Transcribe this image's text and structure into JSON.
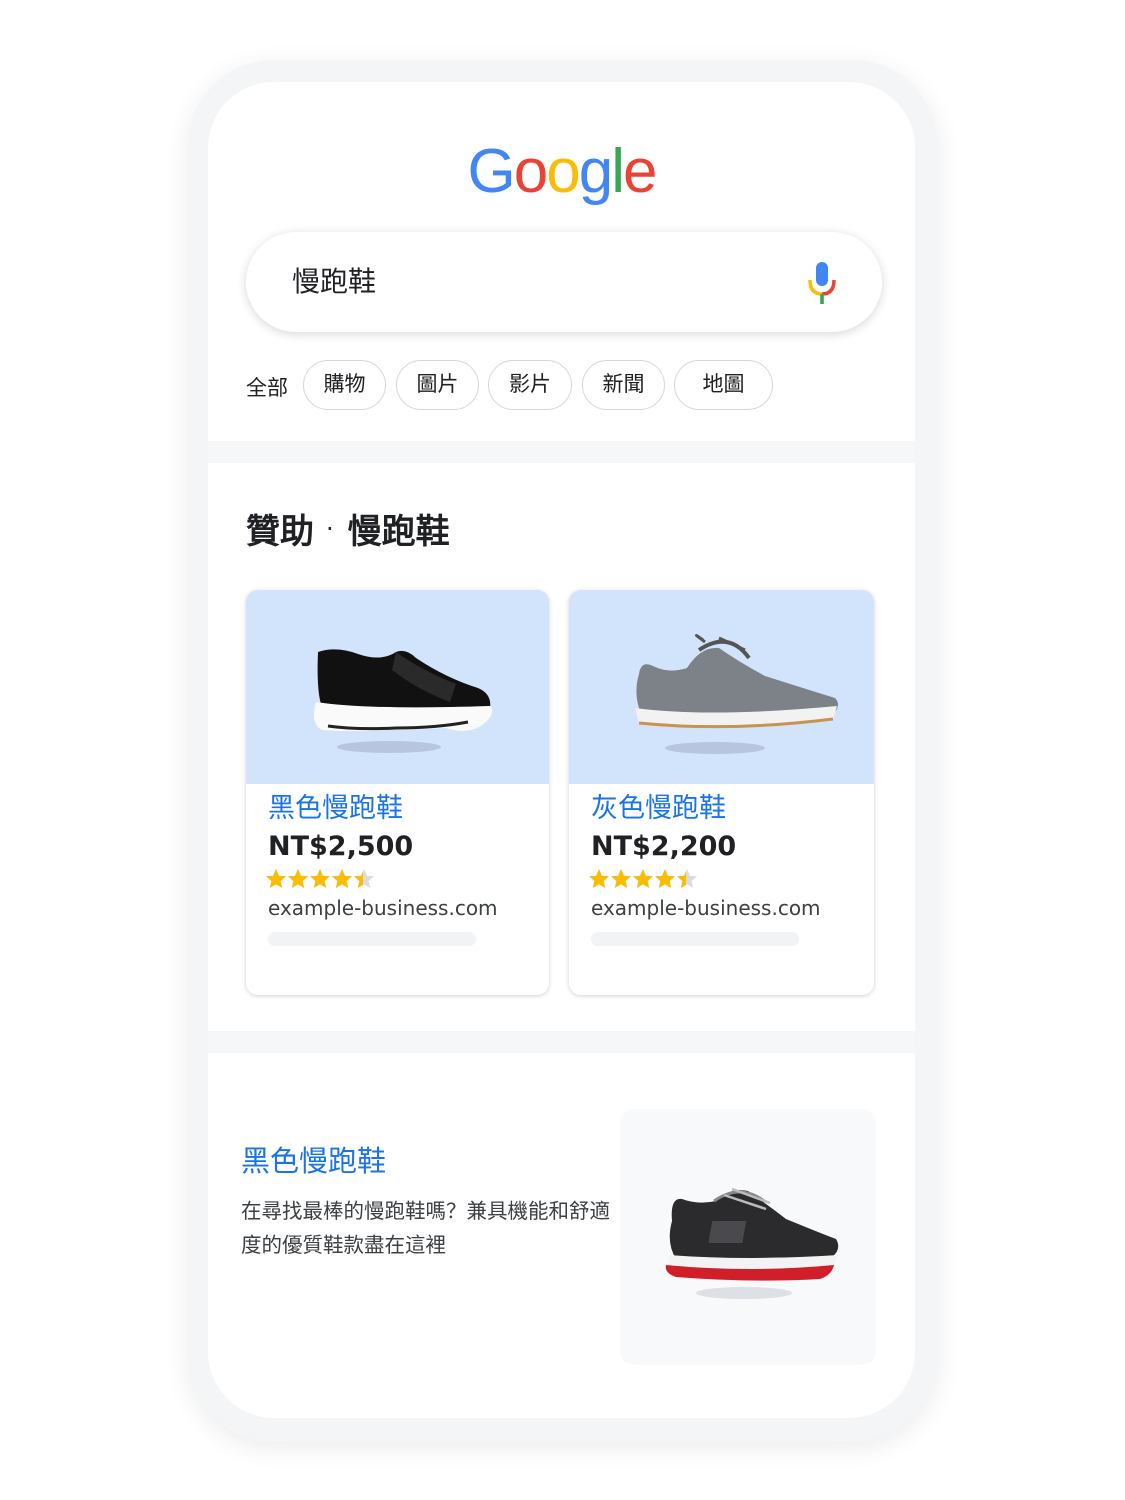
{
  "logo": {
    "letters": [
      {
        "char": "G",
        "color": "#4285F4"
      },
      {
        "char": "o",
        "color": "#EA4335"
      },
      {
        "char": "o",
        "color": "#FBBC05"
      },
      {
        "char": "g",
        "color": "#4285F4"
      },
      {
        "char": "l",
        "color": "#34A853"
      },
      {
        "char": "e",
        "color": "#EA4335"
      }
    ]
  },
  "search": {
    "query": "慢跑鞋",
    "mic_icon": "microphone-icon"
  },
  "chips": {
    "all_label": "全部",
    "items": [
      "購物",
      "圖片",
      "影片",
      "新聞",
      "地圖"
    ]
  },
  "sponsored": {
    "label": "贊助",
    "separator": "·",
    "query": "慢跑鞋"
  },
  "products": [
    {
      "title": "黑色慢跑鞋",
      "price": "NT$2,500",
      "rating": 4.5,
      "domain": "example-business.com",
      "image_icon": "black-slip-on-sneaker"
    },
    {
      "title": "灰色慢跑鞋",
      "price": "NT$2,200",
      "rating": 4.5,
      "domain": "example-business.com",
      "image_icon": "gray-lace-up-sneaker"
    }
  ],
  "result": {
    "title": "黑色慢跑鞋",
    "description": "在尋找最棒的慢跑鞋嗎？兼具機能和舒適度的優質鞋款盡在這裡",
    "image_icon": "black-red-running-shoe"
  },
  "colors": {
    "accent": "#1a73e8",
    "star": "#fbbc04",
    "card_image_bg": "#d2e3fc"
  }
}
